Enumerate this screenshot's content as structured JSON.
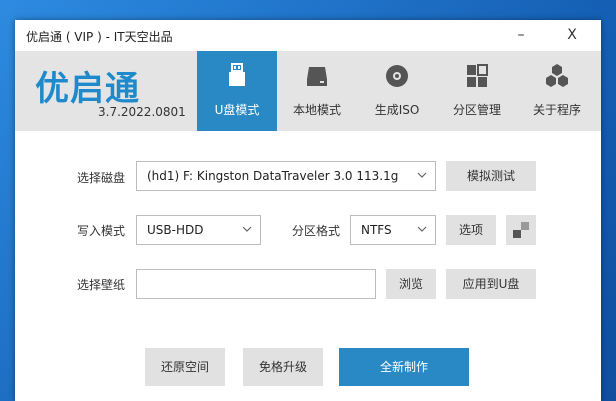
{
  "window": {
    "title": "优启通 ( VIP ) - IT天空出品",
    "minimize": "–",
    "close": "X"
  },
  "header": {
    "logo": "优启通",
    "version": "3.7.2022.0801",
    "nav": [
      {
        "label": "U盘模式",
        "icon": "usb-drive-icon",
        "active": true
      },
      {
        "label": "本地模式",
        "icon": "hard-disk-icon",
        "active": false
      },
      {
        "label": "生成ISO",
        "icon": "disc-icon",
        "active": false
      },
      {
        "label": "分区管理",
        "icon": "partition-grid-icon",
        "active": false
      },
      {
        "label": "关于程序",
        "icon": "hexagon-cluster-icon",
        "active": false
      }
    ]
  },
  "form": {
    "disk_label": "选择磁盘",
    "disk_value": "(hd1) F: Kingston DataTraveler 3.0 113.1g",
    "simulate_button": "模拟测试",
    "write_mode_label": "写入模式",
    "write_mode_value": "USB-HDD",
    "partition_format_label": "分区格式",
    "partition_format_value": "NTFS",
    "options_button": "选项",
    "wallpaper_label": "选择壁纸",
    "wallpaper_value": "",
    "browse_button": "浏览",
    "apply_button": "应用到U盘"
  },
  "actions": {
    "restore_button": "还原空间",
    "upgrade_button": "免格升级",
    "create_button": "全新制作"
  },
  "colors": {
    "accent": "#2889c4",
    "header_bg": "#e4e4e4",
    "button_bg": "#e1e1e1"
  }
}
